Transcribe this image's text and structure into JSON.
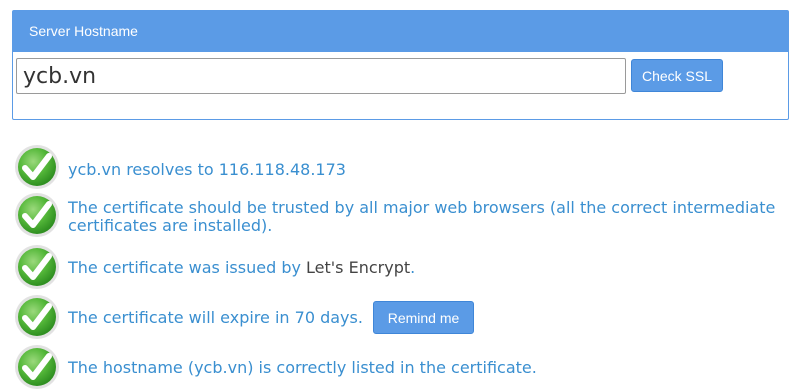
{
  "panel": {
    "header": "Server Hostname",
    "input_value": "ycb.vn",
    "check_button": "Check SSL"
  },
  "results": {
    "resolves": "ycb.vn resolves to 116.118.48.173",
    "trusted": "The certificate should be trusted by all major web browsers (all the correct intermediate certificates are installed).",
    "issued_prefix": "The certificate was issued by ",
    "issuer": "Let's Encrypt",
    "issued_suffix": ".",
    "expire": "The certificate will expire in 70 days.",
    "remind_button": "Remind me",
    "hostname_listed": "The hostname (ycb.vn) is correctly listed in the certificate."
  },
  "colors": {
    "accent": "#5b9be6",
    "result_text": "#3a8fd0",
    "check_green": "#4caf3a"
  },
  "icons": {
    "result_icon": "check-circle-icon"
  }
}
